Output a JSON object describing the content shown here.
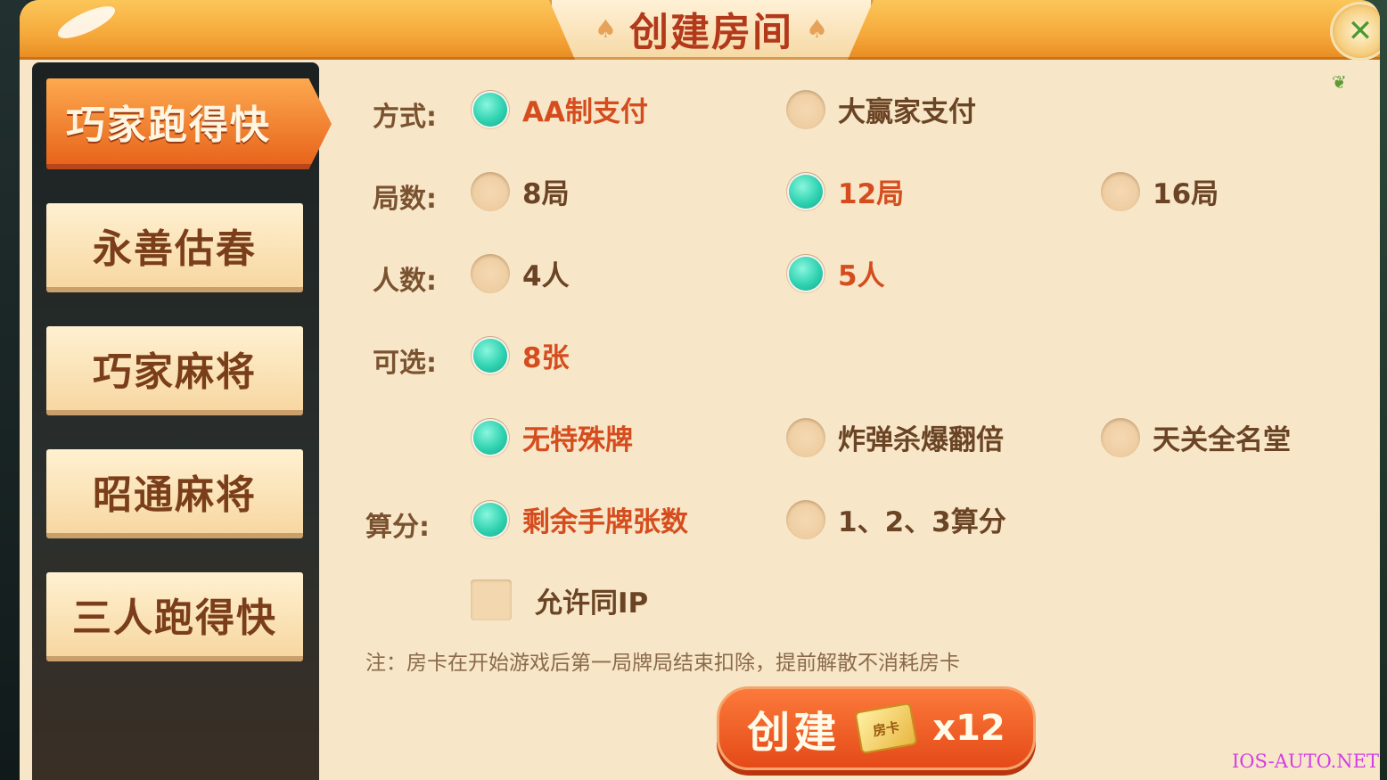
{
  "dialog": {
    "title": "创建房间",
    "close_icon": "close-x-icon"
  },
  "sidebar": {
    "items": [
      {
        "label": "巧家跑得快",
        "active": true
      },
      {
        "label": "永善估春",
        "active": false
      },
      {
        "label": "巧家麻将",
        "active": false
      },
      {
        "label": "昭通麻将",
        "active": false
      },
      {
        "label": "三人跑得快",
        "active": false
      }
    ]
  },
  "options": {
    "payment": {
      "label": "方式:",
      "choices": [
        {
          "label": "AA制支付",
          "selected": true
        },
        {
          "label": "大赢家支付",
          "selected": false
        }
      ]
    },
    "rounds": {
      "label": "局数:",
      "choices": [
        {
          "label": "8局",
          "selected": false
        },
        {
          "label": "12局",
          "selected": true
        },
        {
          "label": "16局",
          "selected": false
        }
      ]
    },
    "players": {
      "label": "人数:",
      "choices": [
        {
          "label": "4人",
          "selected": false
        },
        {
          "label": "5人",
          "selected": true
        }
      ]
    },
    "optional": {
      "label": "可选:",
      "choices": [
        {
          "label": "8张",
          "selected": true
        }
      ]
    },
    "special": {
      "choices": [
        {
          "label": "无特殊牌",
          "selected": true
        },
        {
          "label": "炸弹杀爆翻倍",
          "selected": false
        },
        {
          "label": "天关全名堂",
          "selected": false
        }
      ]
    },
    "scoring": {
      "label": "算分:",
      "choices": [
        {
          "label": "剩余手牌张数",
          "selected": true
        },
        {
          "label": "1、2、3算分",
          "selected": false
        }
      ]
    },
    "same_ip": {
      "label": "允许同IP",
      "checked": false
    }
  },
  "note": "注：房卡在开始游戏后第一局牌局结束扣除，提前解散不消耗房卡",
  "create_button": {
    "label": "创建",
    "card_text": "房卡",
    "cost": "x12"
  },
  "watermark": "IOS-AUTO.NET",
  "colors": {
    "selected_text": "#d54d1e",
    "radio_selected": "#2fd2b0",
    "header": "#f6a93b"
  }
}
